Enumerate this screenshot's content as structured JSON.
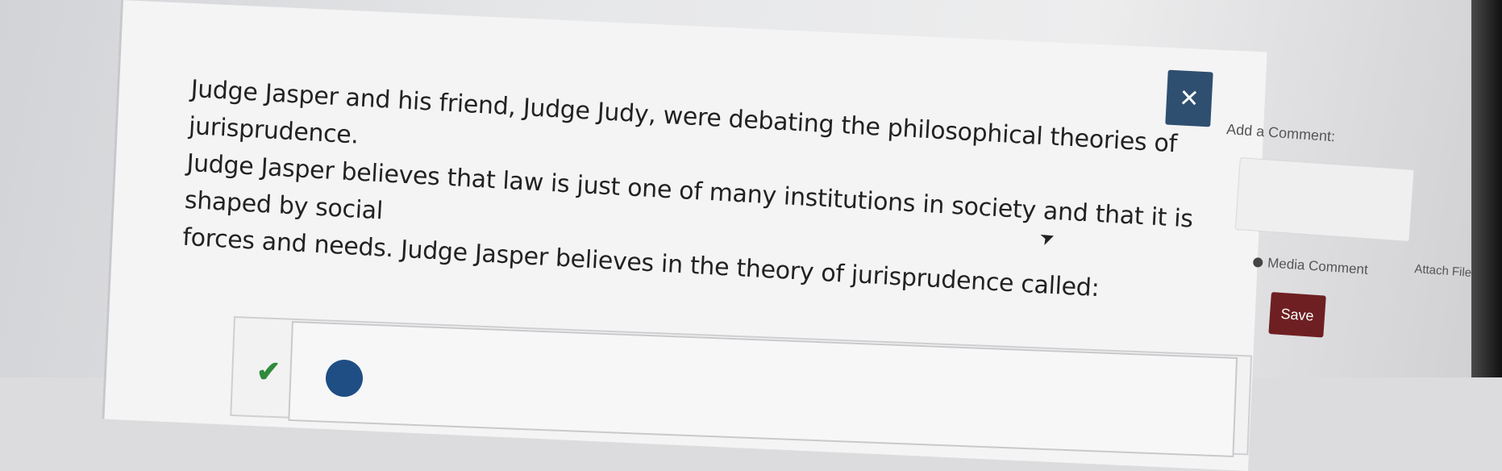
{
  "question": {
    "lines": [
      "Judge Jasper and his friend, Judge Judy, were debating the philosophical theories of jurisprudence.",
      "Judge Jasper believes that law is just one of many institutions in society and that it is shaped by social",
      "forces and needs. Judge Jasper believes in the theory of jurisprudence called:"
    ]
  },
  "close_button": {
    "label": "✕"
  },
  "comment": {
    "title": "Add a Comment:",
    "media_comment": "Media Comment",
    "attach_file": "Attach File",
    "save": "Save"
  },
  "colors": {
    "close_button_bg": "#2f4f70",
    "save_button_bg": "#6e1f22",
    "answer_check": "#2e8b3a",
    "answer_radio": "#1f4e85"
  },
  "icons": [
    "close-icon",
    "media-comment-icon",
    "check-icon",
    "radio-selected-icon",
    "mouse-cursor-icon"
  ]
}
